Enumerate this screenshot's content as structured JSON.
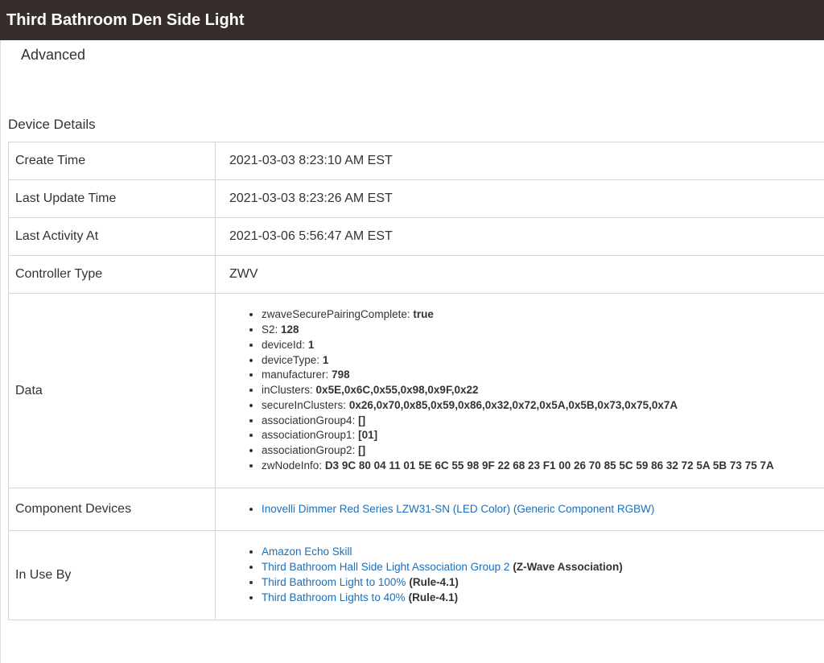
{
  "header": {
    "title": "Third Bathroom Den Side Light"
  },
  "advanced_label": "Advanced",
  "section_title": "Device Details",
  "details": {
    "create_time": {
      "label": "Create Time",
      "value": "2021-03-03 8:23:10 AM EST"
    },
    "last_update_time": {
      "label": "Last Update Time",
      "value": "2021-03-03 8:23:26 AM EST"
    },
    "last_activity_at": {
      "label": "Last Activity At",
      "value": "2021-03-06 5:56:47 AM EST"
    },
    "controller_type": {
      "label": "Controller Type",
      "value": "ZWV"
    }
  },
  "data": {
    "label": "Data",
    "items": [
      {
        "key": "zwaveSecurePairingComplete",
        "value": "true"
      },
      {
        "key": "S2",
        "value": "128"
      },
      {
        "key": "deviceId",
        "value": "1"
      },
      {
        "key": "deviceType",
        "value": "1"
      },
      {
        "key": "manufacturer",
        "value": "798"
      },
      {
        "key": "inClusters",
        "value": "0x5E,0x6C,0x55,0x98,0x9F,0x22"
      },
      {
        "key": "secureInClusters",
        "value": "0x26,0x70,0x85,0x59,0x86,0x32,0x72,0x5A,0x5B,0x73,0x75,0x7A"
      },
      {
        "key": "associationGroup4",
        "value": "[]"
      },
      {
        "key": "associationGroup1",
        "value": "[01]"
      },
      {
        "key": "associationGroup2",
        "value": "[]"
      },
      {
        "key": "zwNodeInfo",
        "value": "D3 9C 80 04 11 01 5E 6C 55 98 9F 22 68 23 F1 00 26 70 85 5C 59 86 32 72 5A 5B 73 75 7A"
      }
    ]
  },
  "component_devices": {
    "label": "Component Devices",
    "items": [
      {
        "name": "Inovelli Dimmer Red Series LZW31-SN (LED Color) (Generic Component RGBW)"
      }
    ]
  },
  "in_use_by": {
    "label": "In Use By",
    "items": [
      {
        "name": "Amazon Echo Skill",
        "tag": ""
      },
      {
        "name": "Third Bathroom Hall Side Light Association Group 2",
        "tag": "(Z-Wave Association)"
      },
      {
        "name": "Third Bathroom Light to 100%",
        "tag": "(Rule-4.1)"
      },
      {
        "name": "Third Bathroom Lights to 40%",
        "tag": "(Rule-4.1)"
      }
    ]
  },
  "colors": {
    "header_bg": "#372e2b",
    "link": "#1b6fb8",
    "border": "#d5d5d5"
  }
}
